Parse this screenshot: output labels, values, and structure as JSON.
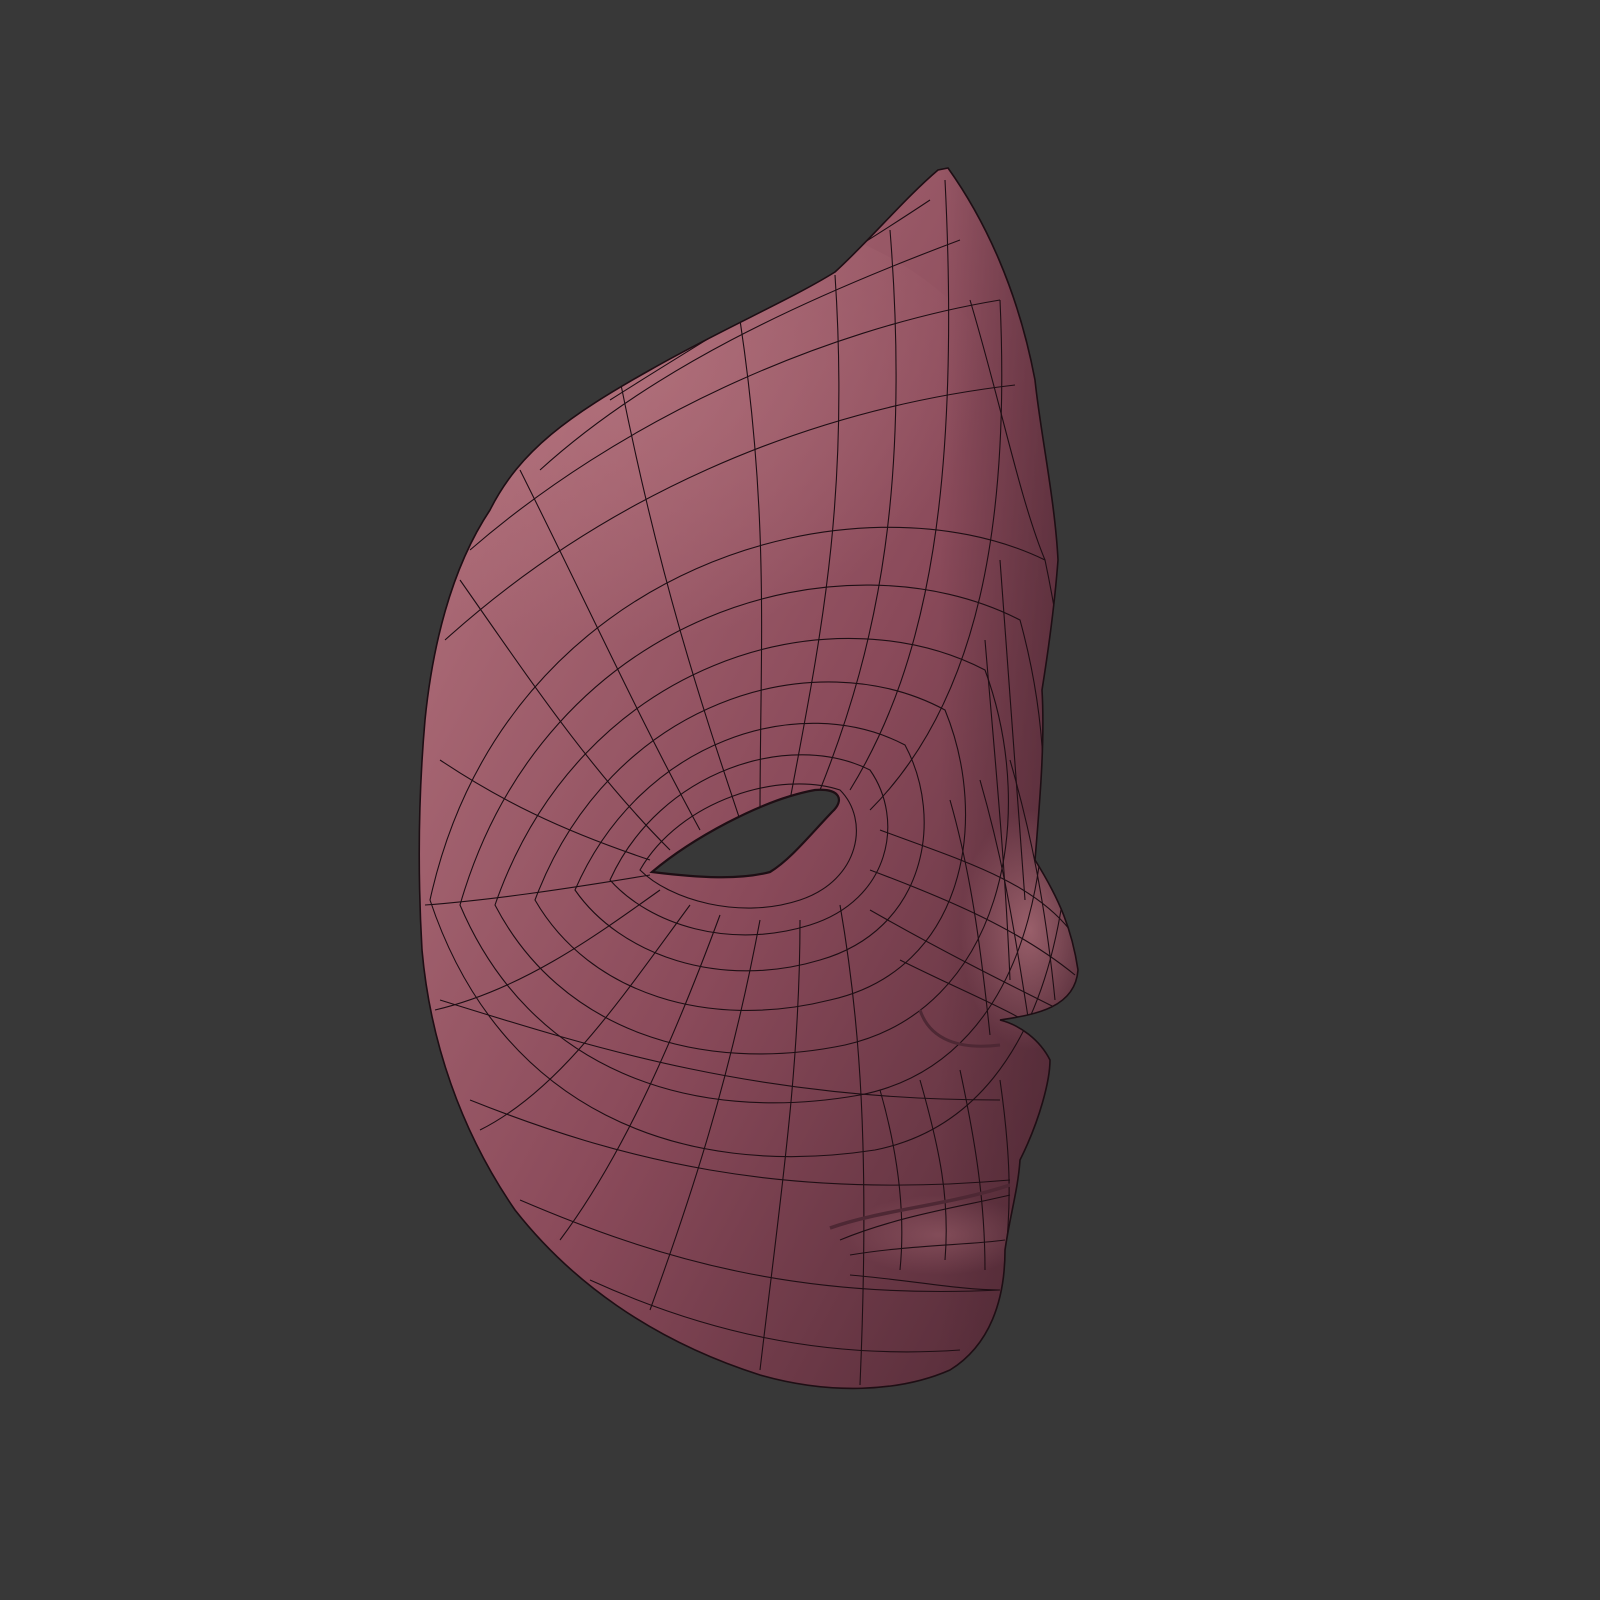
{
  "viewport": {
    "background_color": "#383838"
  },
  "model": {
    "subject": "face-mask",
    "base_color": "#8a4a5a",
    "highlight_color": "#b97882",
    "shadow_color": "#4e2834",
    "wire_color": "#1e0e14",
    "eye_hole_color": "#383838"
  }
}
